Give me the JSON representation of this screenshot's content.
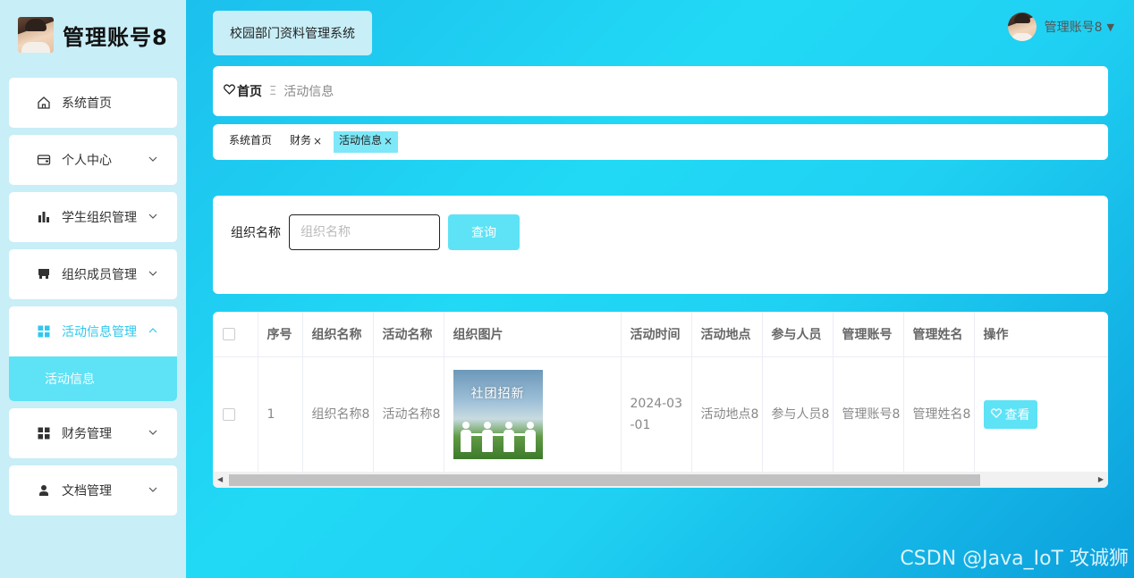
{
  "sidebar": {
    "brand_name": "管理账号8",
    "items": [
      {
        "label": "系统首页",
        "icon": "home-icon"
      },
      {
        "label": "个人中心",
        "icon": "wallet-icon"
      },
      {
        "label": "学生组织管理",
        "icon": "bar-chart-icon"
      },
      {
        "label": "组织成员管理",
        "icon": "store-icon"
      },
      {
        "label": "活动信息管理",
        "icon": "grid-icon"
      },
      {
        "label": "财务管理",
        "icon": "grid-icon"
      },
      {
        "label": "文档管理",
        "icon": "user-icon"
      }
    ],
    "active_submenu": "活动信息",
    "accent_color": "#5ee2f6"
  },
  "header": {
    "system_title": "校园部门资料管理系统",
    "user_name": "管理账号8"
  },
  "breadcrumb": {
    "home": "首页",
    "current": "活动信息"
  },
  "tags": [
    {
      "label": "系统首页",
      "closable": false,
      "active": false
    },
    {
      "label": "财务",
      "closable": true,
      "active": false
    },
    {
      "label": "活动信息",
      "closable": true,
      "active": true
    }
  ],
  "search": {
    "label": "组织名称",
    "placeholder": "组织名称",
    "value": "",
    "button": "查询"
  },
  "table": {
    "columns": [
      "序号",
      "组织名称",
      "活动名称",
      "组织图片",
      "活动时间",
      "活动地点",
      "参与人员",
      "管理账号",
      "管理姓名",
      "操作"
    ],
    "rows": [
      {
        "index": "1",
        "org_name": "组织名称8",
        "activity_name": "活动名称8",
        "image_caption": "社团招新",
        "time": "2024-03-01",
        "location": "活动地点8",
        "participants": "参与人员8",
        "admin_account": "管理账号8",
        "admin_name": "管理姓名8",
        "action": "查看"
      }
    ]
  },
  "watermark": "CSDN @Java_IoT 攻诚狮"
}
